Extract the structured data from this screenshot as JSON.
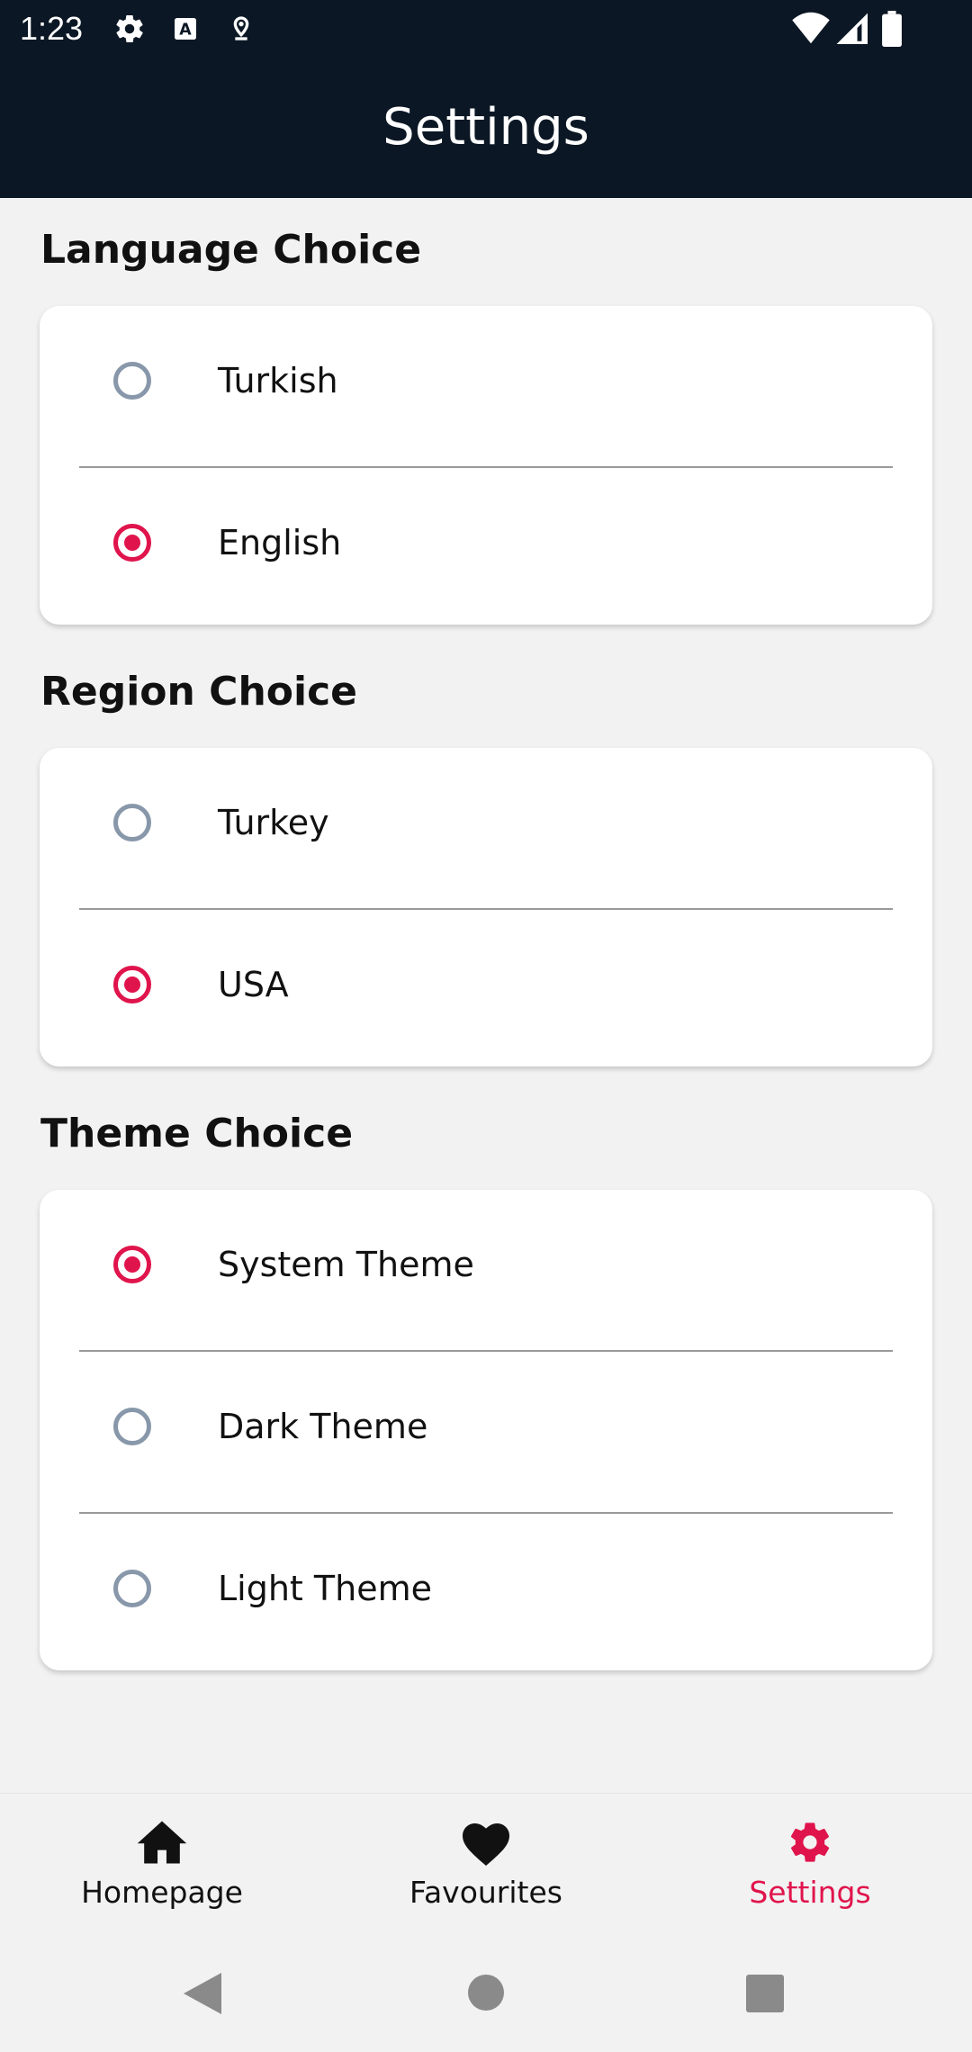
{
  "status_bar": {
    "time": "1:23",
    "icons": [
      "gear-icon",
      "keyboard-a-icon",
      "location-icon",
      "wifi-icon",
      "signal-icon",
      "battery-icon"
    ]
  },
  "app_bar": {
    "title": "Settings"
  },
  "sections": {
    "language": {
      "title": "Language Choice",
      "options": [
        {
          "label": "Turkish",
          "selected": false
        },
        {
          "label": "English",
          "selected": true
        }
      ]
    },
    "region": {
      "title": "Region Choice",
      "options": [
        {
          "label": "Turkey",
          "selected": false
        },
        {
          "label": "USA",
          "selected": true
        }
      ]
    },
    "theme": {
      "title": "Theme Choice",
      "options": [
        {
          "label": "System Theme",
          "selected": true
        },
        {
          "label": "Dark Theme",
          "selected": false
        },
        {
          "label": "Light Theme",
          "selected": false
        }
      ]
    }
  },
  "bottom_nav": {
    "items": [
      {
        "label": "Homepage",
        "icon": "home-icon",
        "active": false
      },
      {
        "label": "Favourites",
        "icon": "heart-icon",
        "active": false
      },
      {
        "label": "Settings",
        "icon": "gear-icon",
        "active": true
      }
    ]
  },
  "system_nav": [
    "back-icon",
    "home-circle-icon",
    "recents-icon"
  ],
  "colors": {
    "app_bar": "#0b1724",
    "accent": "#e0144c",
    "radio_unselected": "#8898aa",
    "background": "#f2f2f3",
    "card": "#ffffff"
  }
}
